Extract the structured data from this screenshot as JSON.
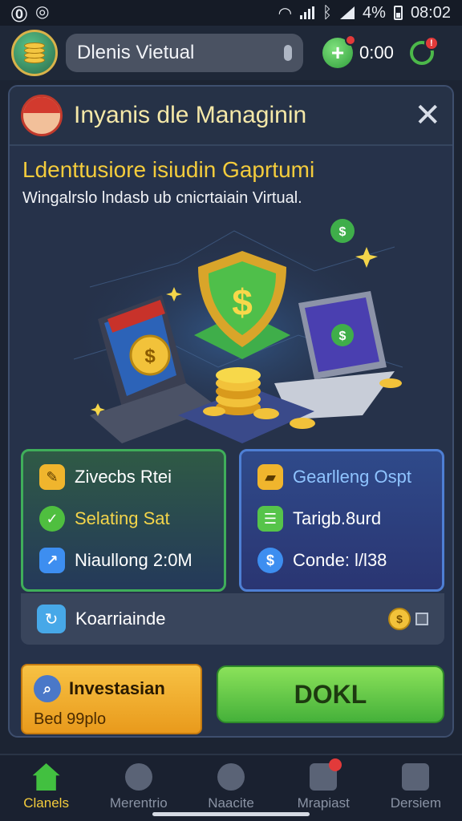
{
  "status_bar": {
    "left_icons": [
      "app-icon-1",
      "app-icon-2"
    ],
    "battery": "4%",
    "time": "08:02"
  },
  "app_bar": {
    "search_text": "Dlenis Vietual",
    "balance": "0:00",
    "notification_badge": "!"
  },
  "panel": {
    "title": "Inyanis dle Managinin",
    "close_label": "✕",
    "subtitle": "Ldenttusiore isiudin Gaprtumi",
    "description": "Wingalrslo lndasb ub cnicrtaiain Virtual."
  },
  "stats_left": [
    {
      "icon": "pencil-badge-icon",
      "label": "Zivecbs Rtei"
    },
    {
      "icon": "check-circle-icon",
      "label": "Selating Sat"
    },
    {
      "icon": "chart-icon",
      "label": "Niaullong 2:0M"
    }
  ],
  "stats_right": [
    {
      "icon": "gold-bar-icon",
      "label": "Gearlleng Ospt"
    },
    {
      "icon": "list-icon",
      "label": "Tarigb.8urd"
    },
    {
      "icon": "dollar-circle-icon",
      "label": "Conde: l/l38"
    }
  ],
  "bottom_strip": {
    "label": "Koarriainde"
  },
  "actions": {
    "invest_title": "Investasian",
    "invest_sub": "Bed 99plo",
    "primary": "DOKL"
  },
  "nav": [
    {
      "label": "Clanels",
      "icon": "home-icon",
      "active": true
    },
    {
      "label": "Merentrio",
      "icon": "gear-icon",
      "active": false
    },
    {
      "label": "Naacite",
      "icon": "compass-icon",
      "active": false
    },
    {
      "label": "Mrapiast",
      "icon": "document-icon",
      "active": false
    },
    {
      "label": "Dersiem",
      "icon": "chart-icon",
      "active": false
    }
  ],
  "colors": {
    "accent_yellow": "#f4cc3c",
    "accent_green": "#45b13a",
    "accent_orange": "#e99a1c",
    "panel_bg": "#26324a"
  }
}
